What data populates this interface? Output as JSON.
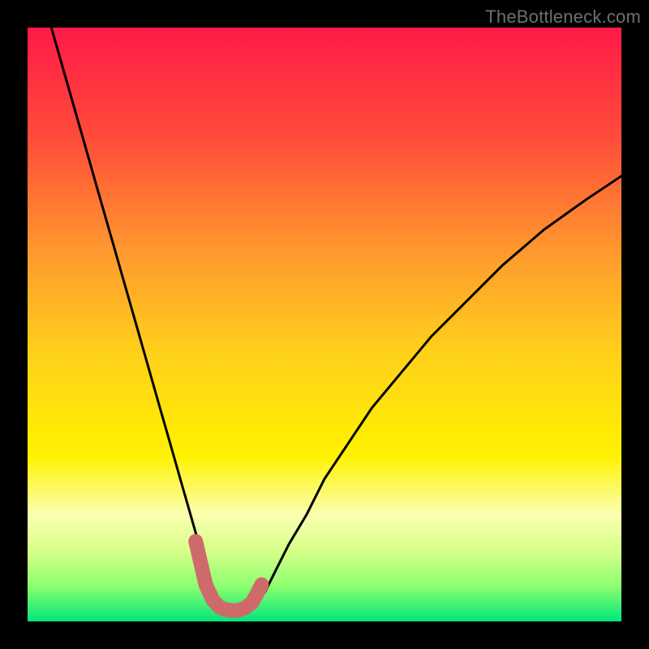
{
  "watermark": {
    "text": "TheBottleneck.com"
  },
  "colors": {
    "background": "#000000",
    "watermark": "#6f6f6f",
    "curve": "#000000",
    "marker": "#cf6a6b",
    "gradient_stops": [
      {
        "offset": 0.0,
        "color": "#ff1a47"
      },
      {
        "offset": 0.18,
        "color": "#ff4a3a"
      },
      {
        "offset": 0.38,
        "color": "#ff9a2e"
      },
      {
        "offset": 0.55,
        "color": "#ffd11a"
      },
      {
        "offset": 0.72,
        "color": "#fff200"
      },
      {
        "offset": 0.82,
        "color": "#fbffb0"
      },
      {
        "offset": 0.88,
        "color": "#d8ff8a"
      },
      {
        "offset": 0.94,
        "color": "#8eff70"
      },
      {
        "offset": 1.0,
        "color": "#00e67a"
      }
    ]
  },
  "chart_data": {
    "type": "line",
    "title": "",
    "xlabel": "",
    "ylabel": "",
    "xlim": [
      0,
      100
    ],
    "ylim": [
      0,
      100
    ],
    "series": [
      {
        "name": "bottleneck-curve",
        "x": [
          4,
          6,
          8,
          10,
          12,
          14,
          16,
          18,
          20,
          22,
          24,
          26,
          28,
          30,
          31.5,
          33,
          34.5,
          36,
          38,
          40,
          42,
          44,
          47,
          50,
          54,
          58,
          63,
          68,
          74,
          80,
          87,
          94,
          100
        ],
        "values": [
          100,
          93,
          86,
          79,
          72,
          65,
          58,
          51,
          44,
          37,
          30,
          23,
          16,
          9,
          5,
          2.5,
          1.8,
          1.8,
          2.5,
          5,
          9,
          13,
          18,
          24,
          30,
          36,
          42,
          48,
          54,
          60,
          66,
          71,
          75
        ]
      }
    ],
    "markers": {
      "name": "highlighted-minimum",
      "x": [
        28.3,
        30.0,
        31.2,
        32.3,
        33.4,
        34.5,
        35.6,
        36.7,
        37.8,
        38.6,
        39.4
      ],
      "values": [
        13.5,
        6.2,
        3.6,
        2.4,
        2.0,
        1.8,
        1.9,
        2.3,
        3.2,
        4.6,
        6.2
      ]
    }
  }
}
